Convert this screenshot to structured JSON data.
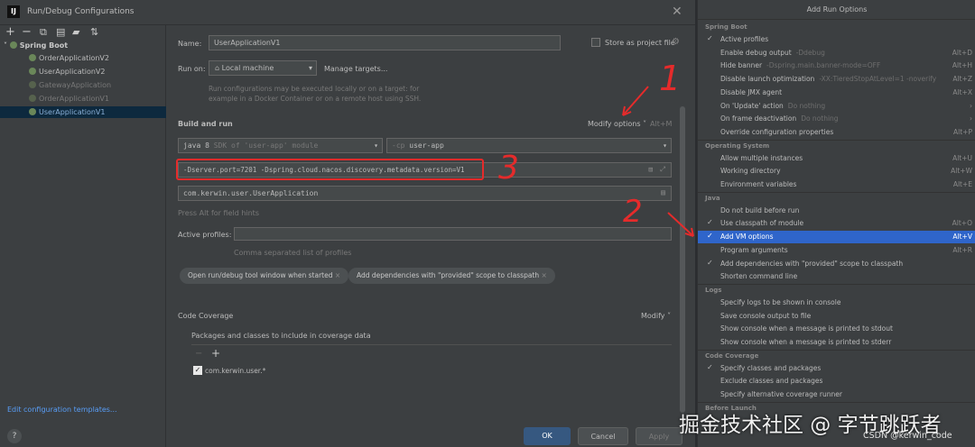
{
  "dialog": {
    "title": "Run/Debug Configurations",
    "app_icon": "IJ"
  },
  "tree": {
    "group": "Spring Boot",
    "items": [
      "OrderApplicationV2",
      "UserApplicationV2",
      "GatewayApplication",
      "OrderApplicationV1",
      "UserApplicationV1"
    ],
    "edit_templates": "Edit configuration templates..."
  },
  "form": {
    "name_label": "Name:",
    "name_value": "UserApplicationV1",
    "store_label": "Store as project file",
    "run_on_label": "Run on:",
    "run_on_value": "Local machine",
    "manage_targets": "Manage targets...",
    "run_on_hint1": "Run configurations may be executed locally or on a target: for",
    "run_on_hint2": "example in a Docker Container or on a remote host using SSH.",
    "build_run_label": "Build and run",
    "modify_options": "Modify options",
    "modify_shortcut": "Alt+M",
    "jdk_value": "java 8",
    "jdk_hint": "SDK of 'user-app' module",
    "cp_flag": "-cp",
    "cp_value": "user-app",
    "vm_options": "-Dserver.port=7201 -Dspring.cloud.nacos.discovery.metadata.version=V1",
    "main_class": "com.kerwin.user.UserApplication",
    "field_hint": "Press Alt for field hints",
    "profiles_label": "Active profiles:",
    "profiles_hint": "Comma separated list of profiles",
    "chip1": "Open run/debug tool window when started",
    "chip2": "Add dependencies with \"provided\" scope to classpath",
    "coverage_label": "Code Coverage",
    "coverage_modify": "Modify",
    "packages_label": "Packages and classes to include in coverage data",
    "package_item": "com.kerwin.user.*"
  },
  "buttons": {
    "ok": "OK",
    "cancel": "Cancel",
    "apply": "Apply",
    "help": "?"
  },
  "menu": {
    "title": "Add Run Options",
    "sections": [
      {
        "name": "Spring Boot",
        "items": [
          {
            "label": "Active profiles",
            "checked": true,
            "hint": "",
            "shortcut": ""
          },
          {
            "label": "Enable debug output",
            "checked": false,
            "hint": "-Ddebug",
            "shortcut": "Alt+D"
          },
          {
            "label": "Hide banner",
            "checked": false,
            "hint": "-Dspring.main.banner-mode=OFF",
            "shortcut": "Alt+H"
          },
          {
            "label": "Disable launch optimization",
            "checked": false,
            "hint": "-XX:TieredStopAtLevel=1 -noverify",
            "shortcut": "Alt+Z"
          },
          {
            "label": "Disable JMX agent",
            "checked": false,
            "hint": "",
            "shortcut": "Alt+X"
          },
          {
            "label": "On 'Update' action",
            "checked": false,
            "hint": "Do nothing",
            "shortcut": "",
            "submenu": true
          },
          {
            "label": "On frame deactivation",
            "checked": false,
            "hint": "Do nothing",
            "shortcut": "",
            "submenu": true
          },
          {
            "label": "Override configuration properties",
            "checked": false,
            "hint": "",
            "shortcut": "Alt+P"
          }
        ]
      },
      {
        "name": "Operating System",
        "items": [
          {
            "label": "Allow multiple instances",
            "checked": false,
            "hint": "",
            "shortcut": "Alt+U"
          },
          {
            "label": "Working directory",
            "checked": false,
            "hint": "",
            "shortcut": "Alt+W"
          },
          {
            "label": "Environment variables",
            "checked": false,
            "hint": "",
            "shortcut": "Alt+E"
          }
        ]
      },
      {
        "name": "Java",
        "items": [
          {
            "label": "Do not build before run",
            "checked": false,
            "hint": "",
            "shortcut": ""
          },
          {
            "label": "Use classpath of module",
            "checked": true,
            "hint": "",
            "shortcut": "Alt+O"
          },
          {
            "label": "Add VM options",
            "checked": true,
            "hint": "",
            "shortcut": "Alt+V",
            "highlight": true
          },
          {
            "label": "Program arguments",
            "checked": false,
            "hint": "",
            "shortcut": "Alt+R"
          },
          {
            "label": "Add dependencies with \"provided\" scope to classpath",
            "checked": true,
            "hint": "",
            "shortcut": ""
          },
          {
            "label": "Shorten command line",
            "checked": false,
            "hint": "",
            "shortcut": ""
          }
        ]
      },
      {
        "name": "Logs",
        "items": [
          {
            "label": "Specify logs to be shown in console",
            "checked": false,
            "hint": "",
            "shortcut": ""
          },
          {
            "label": "Save console output to file",
            "checked": false,
            "hint": "",
            "shortcut": ""
          },
          {
            "label": "Show console when a message is printed to stdout",
            "checked": false,
            "hint": "",
            "shortcut": ""
          },
          {
            "label": "Show console when a message is printed to stderr",
            "checked": false,
            "hint": "",
            "shortcut": ""
          }
        ]
      },
      {
        "name": "Code Coverage",
        "items": [
          {
            "label": "Specify classes and packages",
            "checked": true,
            "hint": "",
            "shortcut": ""
          },
          {
            "label": "Exclude classes and packages",
            "checked": false,
            "hint": "",
            "shortcut": ""
          },
          {
            "label": "Specify alternative coverage runner",
            "checked": false,
            "hint": "",
            "shortcut": ""
          }
        ]
      },
      {
        "name": "Before Launch",
        "items": []
      }
    ]
  },
  "annotations": {
    "n1": "1",
    "n2": "2",
    "n3": "3"
  },
  "watermark": {
    "main": "掘金技术社区 @ 字节跳跃者",
    "sub": "CSDN @kerwin_code"
  },
  "colors": {
    "accent": "#589df6",
    "highlight": "#2f65ca",
    "annotation": "#e52b2b",
    "ok_button": "#365880"
  }
}
